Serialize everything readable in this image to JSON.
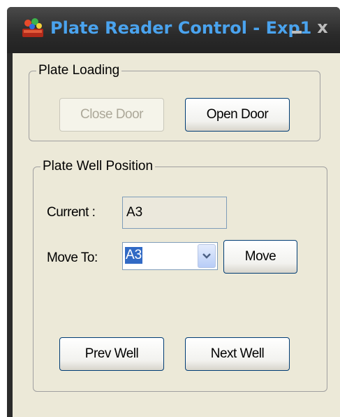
{
  "window": {
    "title": "Plate Reader Control - Exp1",
    "minimize_glyph": "_",
    "close_glyph": "x"
  },
  "plate_loading": {
    "legend": "Plate Loading",
    "close_door_label": "Close Door",
    "close_door_enabled": false,
    "open_door_label": "Open Door"
  },
  "plate_well_position": {
    "legend": "Plate Well Position",
    "current_label": "Current :",
    "current_value": "A3",
    "move_to_label": "Move To:",
    "move_to_value": "A3",
    "move_label": "Move",
    "prev_well_label": "Prev Well",
    "next_well_label": "Next Well"
  },
  "icons": {
    "app": "plate-reader-app-icon",
    "dropdown": "chevron-down-icon"
  },
  "colors": {
    "title_text": "#4aa3ee",
    "titlebar": "#2a2a2a",
    "client_background": "#ece9d8",
    "selection_highlight": "#316ac5",
    "readonly_field": "#ebe8dc"
  }
}
